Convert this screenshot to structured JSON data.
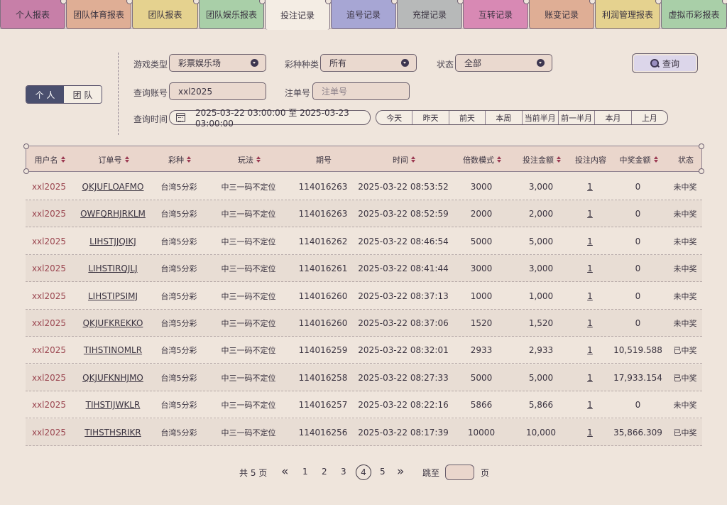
{
  "tabs": [
    {
      "label": "个人报表",
      "color": "#c77fa8"
    },
    {
      "label": "团队体育报表",
      "color": "#dfae95"
    },
    {
      "label": "团队报表",
      "color": "#e5d28f"
    },
    {
      "label": "团队娱乐报表",
      "color": "#a9cfa8"
    },
    {
      "label": "投注记录",
      "color": "#f4ede4"
    },
    {
      "label": "追号记录",
      "color": "#a7a6d4"
    },
    {
      "label": "充提记录",
      "color": "#b7b9b9"
    },
    {
      "label": "互转记录",
      "color": "#d889b4"
    },
    {
      "label": "账变记录",
      "color": "#dfae95"
    },
    {
      "label": "利润管理报表",
      "color": "#e5d28f"
    },
    {
      "label": "虚拟币彩报表",
      "color": "#a9cfa8"
    }
  ],
  "scope_toggle": {
    "personal": "个 人",
    "team": "团 队"
  },
  "filters": {
    "game_type_label": "游戏类型",
    "game_type_value": "彩票娱乐场",
    "lottery_label": "彩种种类",
    "lottery_value": "所有",
    "status_label": "状态",
    "status_value": "全部",
    "account_label": "查询账号",
    "account_value": "xxl2025",
    "order_label": "注单号",
    "order_placeholder": "注单号",
    "time_label": "查询时间",
    "time_range": "2025-03-22 03:00:00 至 2025-03-23 03:00:00",
    "quick_ranges": [
      "今天",
      "昨天",
      "前天",
      "本周",
      "当前半月",
      "前一半月",
      "本月",
      "上月"
    ],
    "search_button": "查询"
  },
  "table": {
    "headers": [
      "用户名",
      "订单号",
      "彩种",
      "玩法",
      "期号",
      "时间",
      "倍数模式",
      "投注金额",
      "投注内容",
      "中奖金额",
      "状态"
    ],
    "rows": [
      [
        "xxl2025",
        "QKJUFLOAFMO",
        "台湾5分彩",
        "中三一码不定位",
        "114016263",
        "2025-03-22 08:53:52",
        "3000",
        "3,000",
        "1",
        "0",
        "未中奖"
      ],
      [
        "xxl2025",
        "OWFQRHJRKLM",
        "台湾5分彩",
        "中三一码不定位",
        "114016263",
        "2025-03-22 08:52:59",
        "2000",
        "2,000",
        "1",
        "0",
        "未中奖"
      ],
      [
        "xxl2025",
        "LIHSTJJQIKJ",
        "台湾5分彩",
        "中三一码不定位",
        "114016262",
        "2025-03-22 08:46:54",
        "5000",
        "5,000",
        "1",
        "0",
        "未中奖"
      ],
      [
        "xxl2025",
        "LIHSTIRQJLJ",
        "台湾5分彩",
        "中三一码不定位",
        "114016261",
        "2025-03-22 08:41:44",
        "3000",
        "3,000",
        "1",
        "0",
        "未中奖"
      ],
      [
        "xxl2025",
        "LIHSTIPSIMJ",
        "台湾5分彩",
        "中三一码不定位",
        "114016260",
        "2025-03-22 08:37:13",
        "1000",
        "1,000",
        "1",
        "0",
        "未中奖"
      ],
      [
        "xxl2025",
        "QKJUFKREKKO",
        "台湾5分彩",
        "中三一码不定位",
        "114016260",
        "2025-03-22 08:37:06",
        "1520",
        "1,520",
        "1",
        "0",
        "未中奖"
      ],
      [
        "xxl2025",
        "TIHSTINOMLR",
        "台湾5分彩",
        "中三一码不定位",
        "114016259",
        "2025-03-22 08:32:01",
        "2933",
        "2,933",
        "1",
        "10,519.588",
        "已中奖"
      ],
      [
        "xxl2025",
        "QKJUFKNHJMO",
        "台湾5分彩",
        "中三一码不定位",
        "114016258",
        "2025-03-22 08:27:33",
        "5000",
        "5,000",
        "1",
        "17,933.154",
        "已中奖"
      ],
      [
        "xxl2025",
        "TIHSTIJWKLR",
        "台湾5分彩",
        "中三一码不定位",
        "114016257",
        "2025-03-22 08:22:16",
        "5866",
        "5,866",
        "1",
        "0",
        "未中奖"
      ],
      [
        "xxl2025",
        "TIHSTHSRIKR",
        "台湾5分彩",
        "中三一码不定位",
        "114016256",
        "2025-03-22 08:17:39",
        "10000",
        "10,000",
        "1",
        "35,866.309",
        "已中奖"
      ]
    ]
  },
  "pagination": {
    "total": "共 5 页",
    "prev_icon": "«",
    "next_icon": "»",
    "pages": [
      "1",
      "2",
      "3",
      "4",
      "5"
    ],
    "current": "4",
    "jump_label": "跳至",
    "page_suffix": "页"
  }
}
